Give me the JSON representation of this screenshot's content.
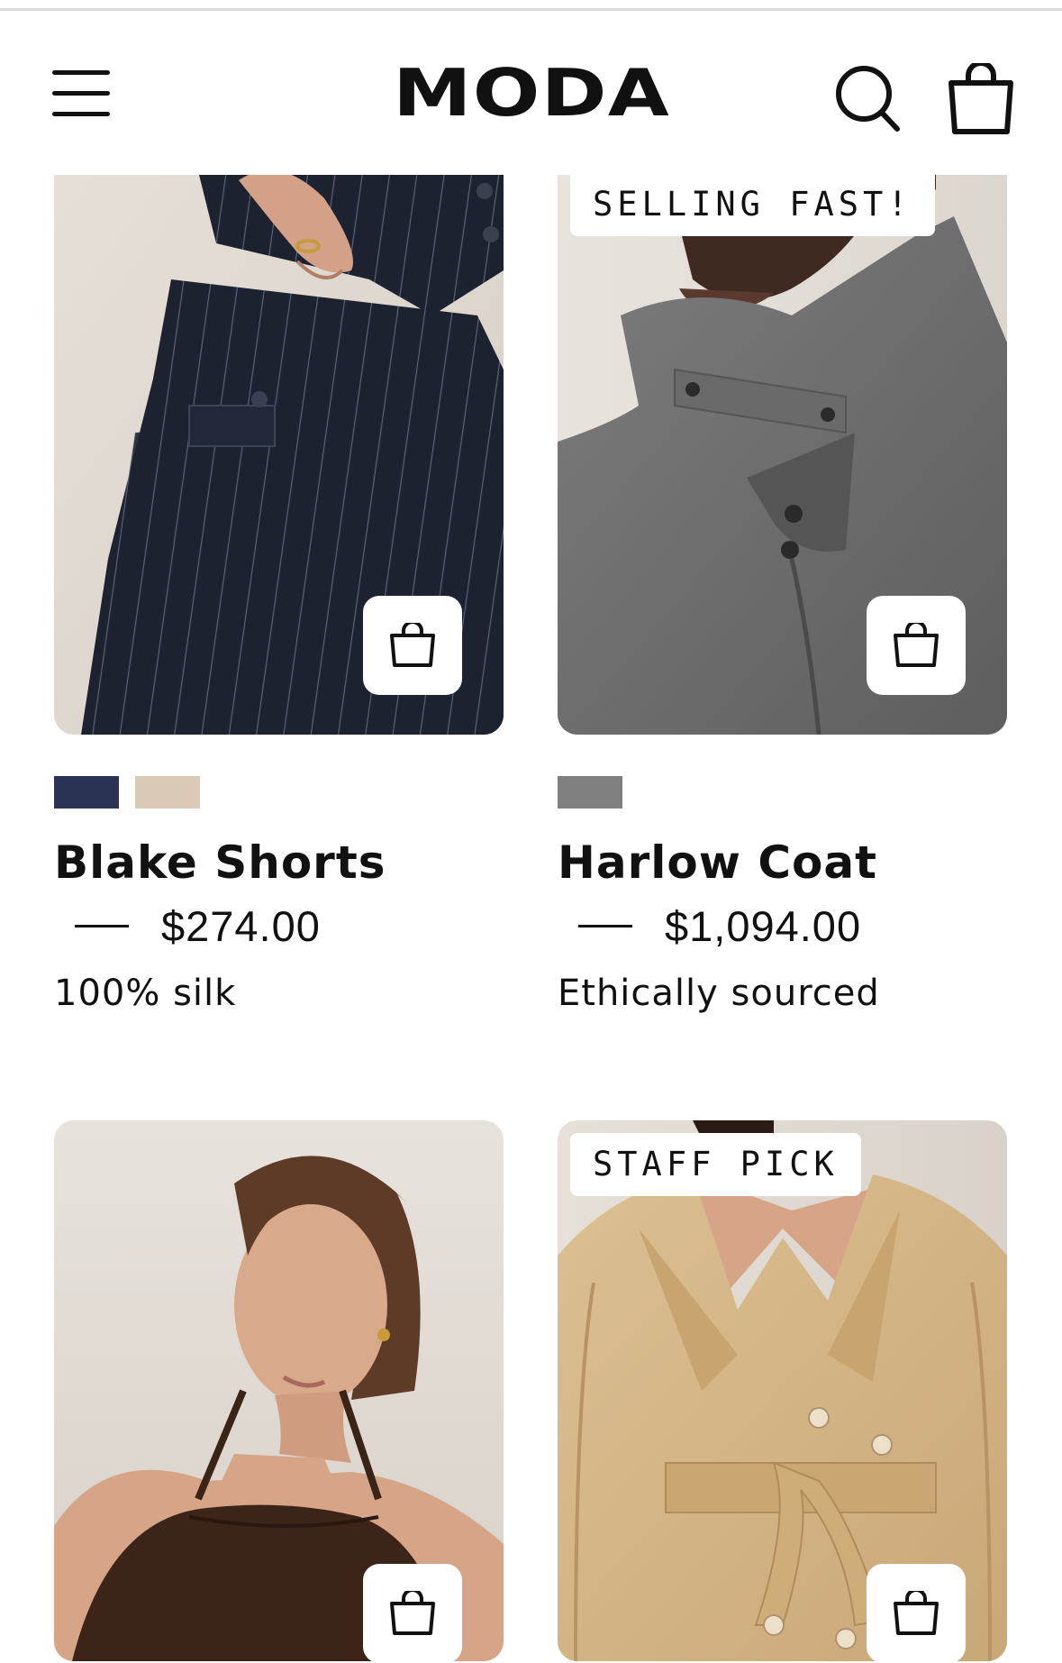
{
  "header": {
    "logo": "MODA",
    "menu_icon": "hamburger-menu-icon",
    "search_icon": "search-icon",
    "cart_icon": "shopping-bag-icon"
  },
  "products": [
    {
      "name": "Blake Shorts",
      "price": "$274.00",
      "note": "100% silk",
      "badge": "",
      "swatches": [
        "#2b3354",
        "#d9c9b6"
      ],
      "image": "navy pinstripe pleated trousers"
    },
    {
      "name": "Harlow Coat",
      "price": "$1,094.00",
      "note": "Ethically sourced",
      "badge": "SELLING FAST!",
      "swatches": [
        "#808080"
      ],
      "image": "grey wool funnel-neck coat"
    },
    {
      "badge": "",
      "image": "woman in brown halter top"
    },
    {
      "badge": "STAFF PICK",
      "image": "beige belted trench coat"
    }
  ]
}
